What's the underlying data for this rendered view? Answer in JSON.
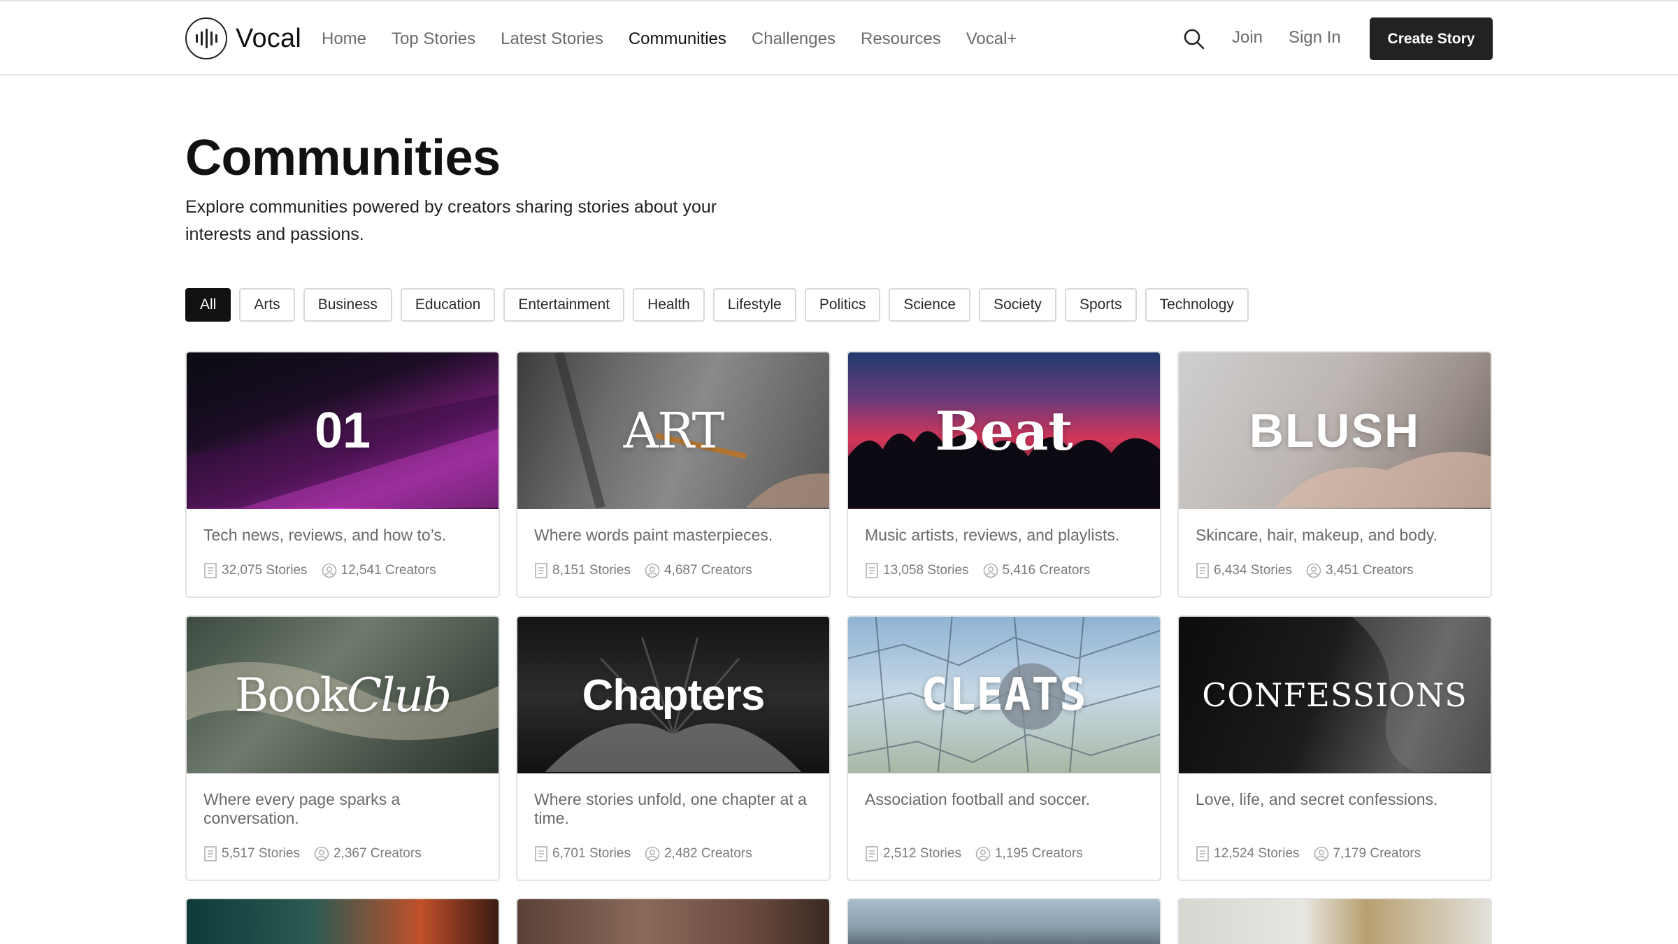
{
  "header": {
    "logo_text": "Vocal",
    "nav": [
      "Home",
      "Top Stories",
      "Latest Stories",
      "Communities",
      "Challenges",
      "Resources",
      "Vocal+"
    ],
    "active_nav": "Communities",
    "join": "Join",
    "sign_in": "Sign In",
    "create_story": "Create Story"
  },
  "page": {
    "title": "Communities",
    "description": "Explore communities powered by creators sharing stories about your interests and passions."
  },
  "filters": [
    "All",
    "Arts",
    "Business",
    "Education",
    "Entertainment",
    "Health",
    "Lifestyle",
    "Politics",
    "Science",
    "Society",
    "Sports",
    "Technology"
  ],
  "active_filter": "All",
  "cards": [
    {
      "name": "01",
      "desc": "Tech news, reviews, and how to’s.",
      "stories": "32,075 Stories",
      "creators": "12,541 Creators"
    },
    {
      "name": "ART",
      "desc": "Where words paint masterpieces.",
      "stories": "8,151 Stories",
      "creators": "4,687 Creators"
    },
    {
      "name": "Beat",
      "desc": "Music artists, reviews, and playlists.",
      "stories": "13,058 Stories",
      "creators": "5,416 Creators"
    },
    {
      "name": "BLUSH",
      "desc": "Skincare, hair, makeup, and body.",
      "stories": "6,434 Stories",
      "creators": "3,451 Creators"
    },
    {
      "name_a": "Book",
      "name_b": "Club",
      "desc": "Where every page sparks a conversation.",
      "stories": "5,517 Stories",
      "creators": "2,367 Creators"
    },
    {
      "name": "Chapters",
      "desc": "Where stories unfold, one chapter at a time.",
      "stories": "6,701 Stories",
      "creators": "2,482 Creators"
    },
    {
      "name": "CLEATS",
      "desc": "Association football and soccer.",
      "stories": "2,512 Stories",
      "creators": "1,195 Creators"
    },
    {
      "name": "CONFESSIONS",
      "desc": "Love, life, and secret confessions.",
      "stories": "12,524 Stories",
      "creators": "7,179 Creators"
    }
  ],
  "colors": {
    "accent": "#222222",
    "border": "#e3e3e3",
    "muted": "#6b6b6b"
  }
}
